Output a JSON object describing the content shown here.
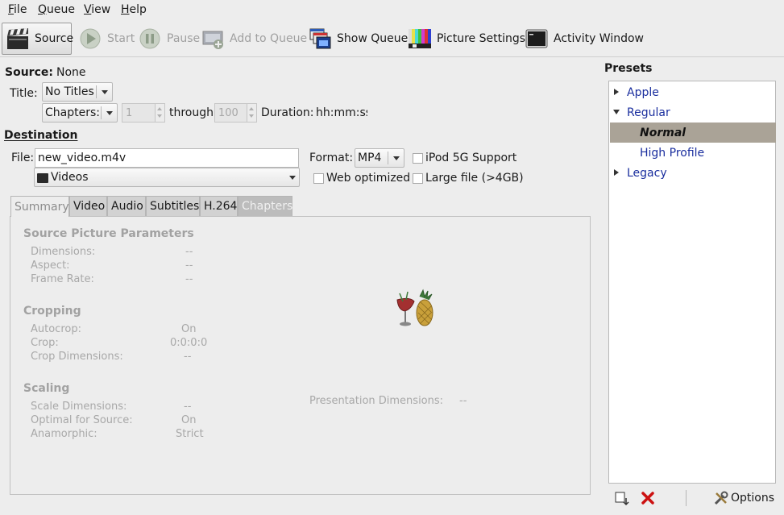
{
  "menu": [
    {
      "label": "File",
      "mnemonic": "F",
      "rest": "ile"
    },
    {
      "label": "Queue",
      "mnemonic": "Q",
      "rest": "ueue"
    },
    {
      "label": "View",
      "mnemonic": "V",
      "rest": "iew"
    },
    {
      "label": "Help",
      "mnemonic": "H",
      "rest": "elp"
    }
  ],
  "toolbar": {
    "source": "Source",
    "start": "Start",
    "pause": "Pause",
    "add_to_queue": "Add to Queue",
    "show_queue": "Show Queue",
    "picture_settings": "Picture Settings",
    "activity_window": "Activity Window"
  },
  "source": {
    "label": "Source:",
    "value": "None",
    "title_label": "Title:",
    "title_value": "No Titles",
    "chapters_label": "Chapters:",
    "chapter_start": "1",
    "through": "through",
    "chapter_end": "100",
    "duration_label": "Duration:",
    "duration_value": "hh:mm:ss"
  },
  "destination": {
    "heading": "Destination",
    "file_label": "File:",
    "file_value": "new_video.m4v",
    "folder": "Videos",
    "format_label": "Format:",
    "format_value": "MP4",
    "ipod": "iPod 5G Support",
    "web_optimized": "Web optimized",
    "large_file": "Large file (>4GB)"
  },
  "tabs": [
    "Summary",
    "Video",
    "Audio",
    "Subtitles",
    "H.264",
    "Chapters"
  ],
  "summary": {
    "source_params_title": "Source Picture Parameters",
    "dimensions_label": "Dimensions:",
    "dimensions_value": "--",
    "aspect_label": "Aspect:",
    "aspect_value": "--",
    "frame_rate_label": "Frame Rate:",
    "frame_rate_value": "--",
    "cropping_title": "Cropping",
    "autocrop_label": "Autocrop:",
    "autocrop_value": "On",
    "crop_label": "Crop:",
    "crop_value": "0:0:0:0",
    "crop_dims_label": "Crop Dimensions:",
    "crop_dims_value": "--",
    "scaling_title": "Scaling",
    "scale_dims_label": "Scale Dimensions:",
    "scale_dims_value": "--",
    "optimal_label": "Optimal for Source:",
    "optimal_value": "On",
    "anamorphic_label": "Anamorphic:",
    "anamorphic_value": "Strict",
    "presentation_label": "Presentation Dimensions:",
    "presentation_value": "--"
  },
  "presets": {
    "heading": "Presets",
    "items": [
      "Apple",
      "Regular",
      "Normal",
      "High Profile",
      "Legacy"
    ],
    "options": "Options"
  },
  "colors": {
    "selected_preset": "#aaa397",
    "tree_text": "#1a2e9e",
    "remove_icon": "#cc1111"
  }
}
